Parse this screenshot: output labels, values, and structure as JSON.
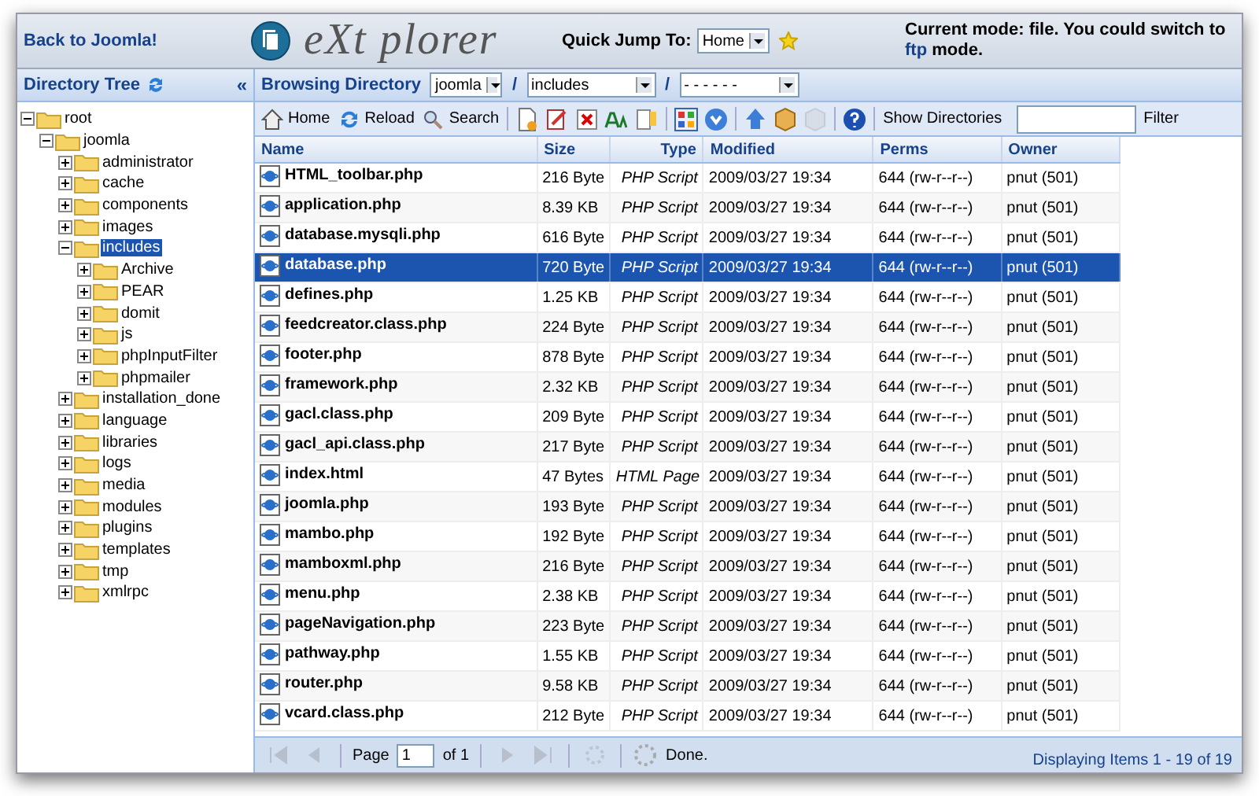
{
  "header": {
    "back_link": "Back to Joomla!",
    "logo_text": "eXt plorer",
    "quick_jump_label": "Quick Jump To:",
    "quick_jump_value": "Home",
    "mode_link": "ftp",
    "mode_before": "Current mode: file. You could switch to",
    "mode_after": "mode."
  },
  "sidebar": {
    "title": "Directory Tree",
    "collapse": "«",
    "tree": [
      {
        "label": "root",
        "expanded": true,
        "selected": false,
        "children": [
          {
            "label": "joomla",
            "expanded": true,
            "selected": false,
            "children": [
              {
                "label": "administrator",
                "expanded": false,
                "selected": false
              },
              {
                "label": "cache",
                "expanded": false,
                "selected": false
              },
              {
                "label": "components",
                "expanded": false,
                "selected": false
              },
              {
                "label": "images",
                "expanded": false,
                "selected": false
              },
              {
                "label": "includes",
                "expanded": true,
                "selected": true,
                "children": [
                  {
                    "label": "Archive",
                    "expanded": false,
                    "selected": false
                  },
                  {
                    "label": "PEAR",
                    "expanded": false,
                    "selected": false
                  },
                  {
                    "label": "domit",
                    "expanded": false,
                    "selected": false
                  },
                  {
                    "label": "js",
                    "expanded": false,
                    "selected": false
                  },
                  {
                    "label": "phpInputFilter",
                    "expanded": false,
                    "selected": false
                  },
                  {
                    "label": "phpmailer",
                    "expanded": false,
                    "selected": false
                  }
                ]
              },
              {
                "label": "installation_done",
                "expanded": false,
                "selected": false
              },
              {
                "label": "language",
                "expanded": false,
                "selected": false
              },
              {
                "label": "libraries",
                "expanded": false,
                "selected": false
              },
              {
                "label": "logs",
                "expanded": false,
                "selected": false
              },
              {
                "label": "media",
                "expanded": false,
                "selected": false
              },
              {
                "label": "modules",
                "expanded": false,
                "selected": false
              },
              {
                "label": "plugins",
                "expanded": false,
                "selected": false
              },
              {
                "label": "templates",
                "expanded": false,
                "selected": false
              },
              {
                "label": "tmp",
                "expanded": false,
                "selected": false
              },
              {
                "label": "xmlrpc",
                "expanded": false,
                "selected": false
              }
            ]
          }
        ]
      }
    ]
  },
  "browse_bar": {
    "label": "Browsing Directory",
    "path": [
      "joomla",
      "includes",
      "- - - - - -"
    ],
    "separator": "/"
  },
  "toolbar": {
    "buttons": [
      {
        "label": "Home"
      },
      {
        "label": "Reload"
      },
      {
        "label": "Search"
      }
    ],
    "show_directories": "Show Directories",
    "filter_label": "Filter"
  },
  "table": {
    "columns": [
      "Name",
      "Size",
      "Type",
      "Modified",
      "Perms",
      "Owner"
    ],
    "rows": [
      {
        "name": "HTML_toolbar.php",
        "size": "216 Byte",
        "type": "PHP Script",
        "modified": "2009/03/27 19:34",
        "perms": "644 (rw-r--r--)",
        "owner": "pnut (501)",
        "selected": false
      },
      {
        "name": "application.php",
        "size": "8.39 KB",
        "type": "PHP Script",
        "modified": "2009/03/27 19:34",
        "perms": "644 (rw-r--r--)",
        "owner": "pnut (501)",
        "selected": false
      },
      {
        "name": "database.mysqli.php",
        "size": "616 Byte",
        "type": "PHP Script",
        "modified": "2009/03/27 19:34",
        "perms": "644 (rw-r--r--)",
        "owner": "pnut (501)",
        "selected": false
      },
      {
        "name": "database.php",
        "size": "720 Byte",
        "type": "PHP Script",
        "modified": "2009/03/27 19:34",
        "perms": "644 (rw-r--r--)",
        "owner": "pnut (501)",
        "selected": true
      },
      {
        "name": "defines.php",
        "size": "1.25 KB",
        "type": "PHP Script",
        "modified": "2009/03/27 19:34",
        "perms": "644 (rw-r--r--)",
        "owner": "pnut (501)",
        "selected": false
      },
      {
        "name": "feedcreator.class.php",
        "size": "224 Byte",
        "type": "PHP Script",
        "modified": "2009/03/27 19:34",
        "perms": "644 (rw-r--r--)",
        "owner": "pnut (501)",
        "selected": false
      },
      {
        "name": "footer.php",
        "size": "878 Byte",
        "type": "PHP Script",
        "modified": "2009/03/27 19:34",
        "perms": "644 (rw-r--r--)",
        "owner": "pnut (501)",
        "selected": false
      },
      {
        "name": "framework.php",
        "size": "2.32 KB",
        "type": "PHP Script",
        "modified": "2009/03/27 19:34",
        "perms": "644 (rw-r--r--)",
        "owner": "pnut (501)",
        "selected": false
      },
      {
        "name": "gacl.class.php",
        "size": "209 Byte",
        "type": "PHP Script",
        "modified": "2009/03/27 19:34",
        "perms": "644 (rw-r--r--)",
        "owner": "pnut (501)",
        "selected": false
      },
      {
        "name": "gacl_api.class.php",
        "size": "217 Byte",
        "type": "PHP Script",
        "modified": "2009/03/27 19:34",
        "perms": "644 (rw-r--r--)",
        "owner": "pnut (501)",
        "selected": false
      },
      {
        "name": "index.html",
        "size": "47 Bytes",
        "type": "HTML Page",
        "modified": "2009/03/27 19:34",
        "perms": "644 (rw-r--r--)",
        "owner": "pnut (501)",
        "selected": false
      },
      {
        "name": "joomla.php",
        "size": "193 Byte",
        "type": "PHP Script",
        "modified": "2009/03/27 19:34",
        "perms": "644 (rw-r--r--)",
        "owner": "pnut (501)",
        "selected": false
      },
      {
        "name": "mambo.php",
        "size": "192 Byte",
        "type": "PHP Script",
        "modified": "2009/03/27 19:34",
        "perms": "644 (rw-r--r--)",
        "owner": "pnut (501)",
        "selected": false
      },
      {
        "name": "mamboxml.php",
        "size": "216 Byte",
        "type": "PHP Script",
        "modified": "2009/03/27 19:34",
        "perms": "644 (rw-r--r--)",
        "owner": "pnut (501)",
        "selected": false
      },
      {
        "name": "menu.php",
        "size": "2.38 KB",
        "type": "PHP Script",
        "modified": "2009/03/27 19:34",
        "perms": "644 (rw-r--r--)",
        "owner": "pnut (501)",
        "selected": false
      },
      {
        "name": "pageNavigation.php",
        "size": "223 Byte",
        "type": "PHP Script",
        "modified": "2009/03/27 19:34",
        "perms": "644 (rw-r--r--)",
        "owner": "pnut (501)",
        "selected": false
      },
      {
        "name": "pathway.php",
        "size": "1.55 KB",
        "type": "PHP Script",
        "modified": "2009/03/27 19:34",
        "perms": "644 (rw-r--r--)",
        "owner": "pnut (501)",
        "selected": false
      },
      {
        "name": "router.php",
        "size": "9.58 KB",
        "type": "PHP Script",
        "modified": "2009/03/27 19:34",
        "perms": "644 (rw-r--r--)",
        "owner": "pnut (501)",
        "selected": false
      },
      {
        "name": "vcard.class.php",
        "size": "212 Byte",
        "type": "PHP Script",
        "modified": "2009/03/27 19:34",
        "perms": "644 (rw-r--r--)",
        "owner": "pnut (501)",
        "selected": false
      }
    ]
  },
  "paging": {
    "page_label": "Page",
    "page_value": "1",
    "of_label": "of 1",
    "status": "Done.",
    "display_info": "Displaying Items 1 - 19 of 19"
  }
}
